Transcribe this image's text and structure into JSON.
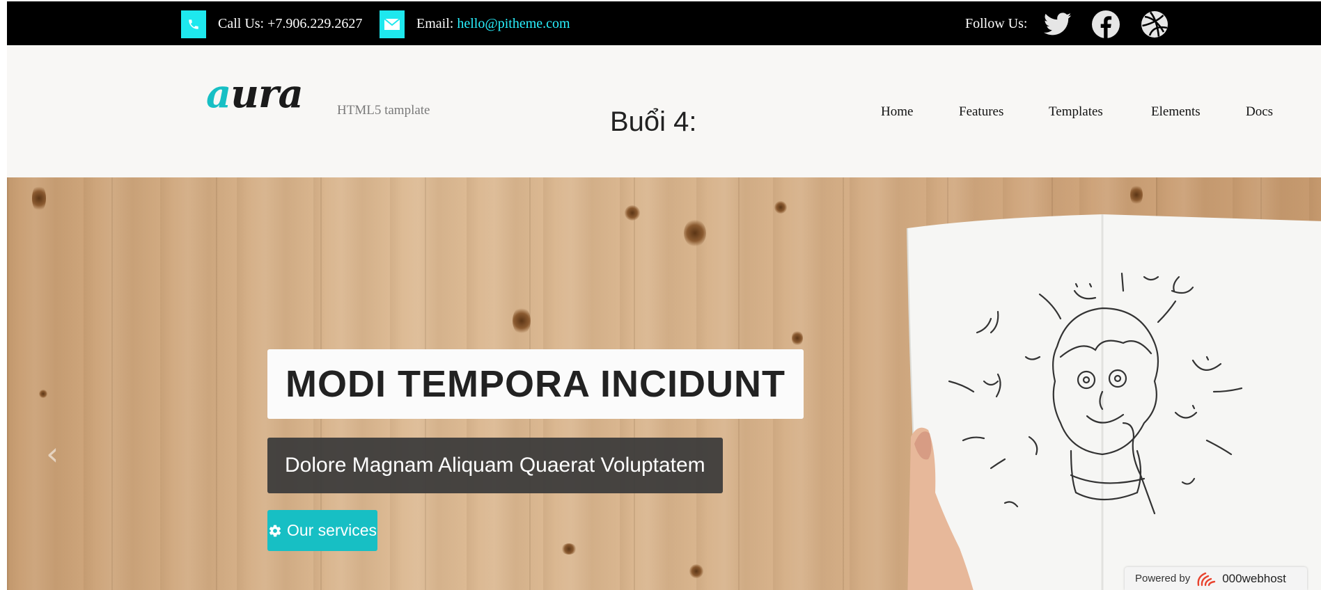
{
  "topbar": {
    "phone_text": "Call Us: +7.906.229.2627",
    "email_label": "Email:",
    "email_link": "hello@pitheme.com",
    "follow_label": "Follow Us:",
    "icons": [
      "phone-icon",
      "mail-icon",
      "twitter-icon",
      "facebook-icon",
      "dribbble-icon"
    ]
  },
  "header": {
    "logo_first": "a",
    "logo_rest": "ura",
    "tagline": "HTML5 tamplate",
    "session_label": "Buổi 4:",
    "nav": [
      "Home",
      "Features",
      "Templates",
      "Elements",
      "Docs"
    ]
  },
  "hero": {
    "title": "MODI TEMPORA INCIDUNT",
    "subtitle": "Dolore Magnam Aliquam Quaerat Voluptatem",
    "button_label": "Our services",
    "prev_arrow": "‹"
  },
  "footer_badge": {
    "powered_by": "Powered by",
    "brand": "000webhost"
  },
  "colors": {
    "accent": "#17bfc4",
    "topbar_bg": "#000000",
    "topbar_icon_bg": "#1ee8ee",
    "email_link": "#29f1ff",
    "header_bg": "#f8f7f5"
  }
}
